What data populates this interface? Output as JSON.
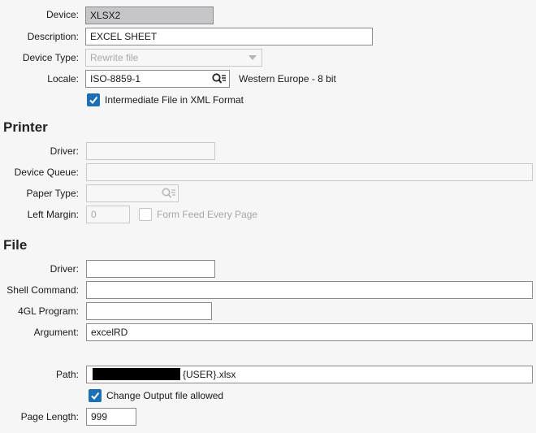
{
  "device": {
    "label": "Device:",
    "value": "XLSX2"
  },
  "description": {
    "label": "Description:",
    "value": "EXCEL SHEET"
  },
  "device_type": {
    "label": "Device Type:",
    "value": "Rewrite file"
  },
  "locale": {
    "label": "Locale:",
    "value": "ISO-8859-1",
    "info": "Western Europe - 8 bit"
  },
  "xml_checkbox": {
    "label": "Intermediate File in XML Format",
    "checked": true
  },
  "printer": {
    "heading": "Printer",
    "driver": {
      "label": "Driver:",
      "value": ""
    },
    "device_queue": {
      "label": "Device Queue:",
      "value": ""
    },
    "paper_type": {
      "label": "Paper Type:",
      "value": ""
    },
    "left_margin": {
      "label": "Left Margin:",
      "value": "0"
    },
    "form_feed": {
      "label": "Form Feed Every Page",
      "checked": false
    }
  },
  "file": {
    "heading": "File",
    "driver": {
      "label": "Driver:",
      "value": ""
    },
    "shell_command": {
      "label": "Shell Command:",
      "value": ""
    },
    "program_4gl": {
      "label": "4GL Program:",
      "value": ""
    },
    "argument": {
      "label": "Argument:",
      "value": "excelRD"
    },
    "path": {
      "label": "Path:",
      "value": "{USER}.xlsx"
    },
    "change_output": {
      "label": "Change Output file allowed",
      "checked": true
    },
    "page_length": {
      "label": "Page Length:",
      "value": "999"
    }
  }
}
